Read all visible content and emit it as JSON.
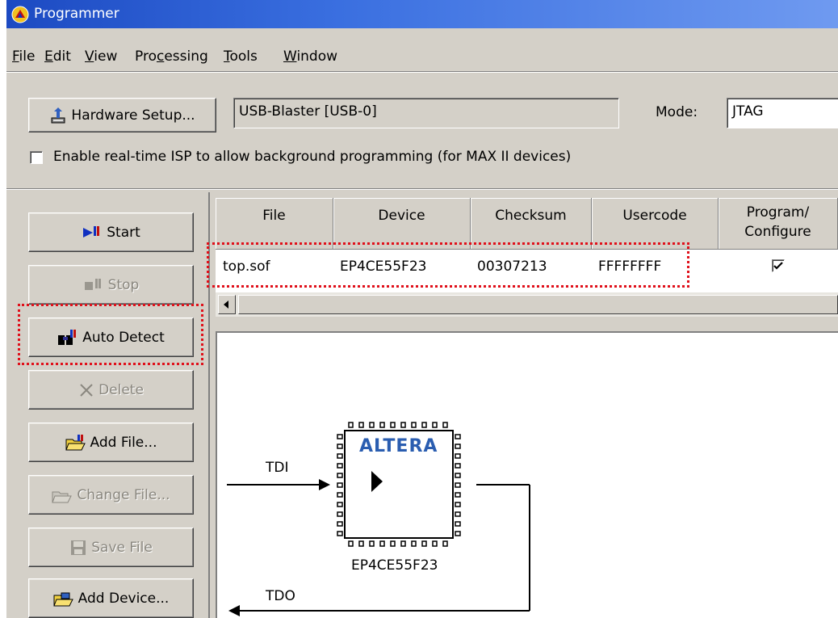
{
  "window": {
    "title": "Programmer"
  },
  "menu": {
    "items": [
      {
        "label": "File",
        "key": "F",
        "rest": "ile"
      },
      {
        "label": "Edit",
        "key": "E",
        "rest": "dit"
      },
      {
        "label": "View",
        "key": "V",
        "rest": "iew"
      },
      {
        "label": "Processing",
        "pre": "Pro",
        "key": "c",
        "rest": "essing"
      },
      {
        "label": "Tools",
        "key": "T",
        "rest": "ools"
      },
      {
        "label": "Window",
        "key": "W",
        "rest": "indow"
      }
    ]
  },
  "toolbar": {
    "hardware_setup_label": "Hardware Setup...",
    "hardware_value": "USB-Blaster [USB-0]",
    "mode_label": "Mode:",
    "mode_value": "JTAG",
    "isp_checkbox_label": "Enable real-time ISP to allow background programming (for MAX II devices)",
    "isp_checked": false
  },
  "side_buttons": {
    "start": "Start",
    "stop": "Stop",
    "auto_detect": "Auto Detect",
    "delete": "Delete",
    "add_file": "Add File...",
    "change_file": "Change File...",
    "save_file": "Save File",
    "add_device": "Add Device..."
  },
  "table": {
    "columns": [
      "File",
      "Device",
      "Checksum",
      "Usercode",
      "Program/\nConfigure"
    ],
    "rows": [
      {
        "file": "top.sof",
        "device": "EP4CE55F23",
        "checksum": "00307213",
        "usercode": "FFFFFFFF",
        "program_configure": true
      }
    ]
  },
  "chain": {
    "tdi_label": "TDI",
    "tdo_label": "TDO",
    "chip_logo": "ALTERA",
    "chip_name": "EP4CE55F23"
  },
  "colors": {
    "highlight": "#e0101a",
    "titlebar": "#1c4ac2",
    "face": "#d4d0c8"
  }
}
